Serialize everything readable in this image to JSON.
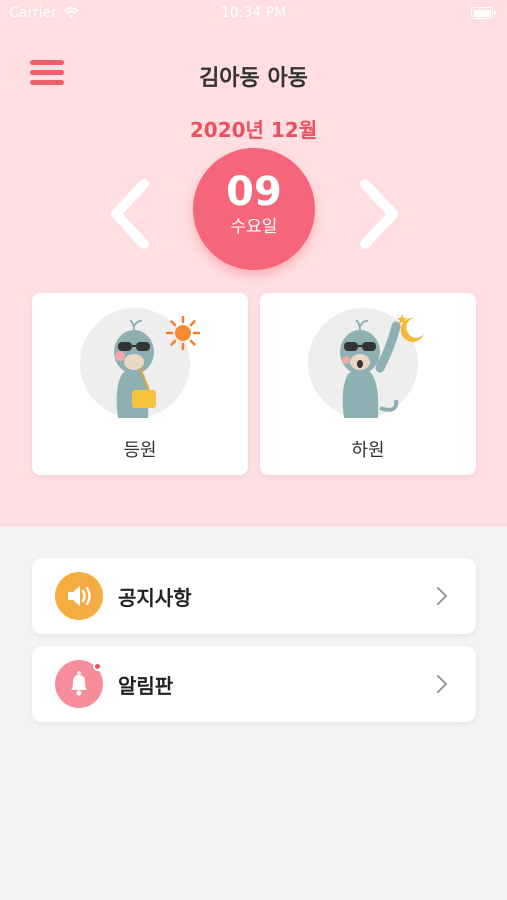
{
  "status_bar": {
    "carrier": "Carrier",
    "time": "10:34 PM"
  },
  "header": {
    "title": "김아동 아동",
    "menu_icon": "hamburger-icon"
  },
  "calendar": {
    "month_label": "2020년 12월",
    "day": "09",
    "weekday": "수요일",
    "prev_icon": "chevron-left-icon",
    "next_icon": "chevron-right-icon"
  },
  "cards": [
    {
      "label": "등원",
      "icon": "sun-icon"
    },
    {
      "label": "하원",
      "icon": "moon-icon"
    }
  ],
  "menu_items": [
    {
      "label": "공지사항",
      "icon": "speaker-icon",
      "color": "#f5ad42"
    },
    {
      "label": "알림판",
      "icon": "bell-icon",
      "color": "#f98c9b"
    }
  ],
  "colors": {
    "header_bg": "#ffdfe2",
    "accent": "#ee4f5e",
    "day_circle": "#f6667a",
    "page_bg": "#f3f3f3"
  }
}
